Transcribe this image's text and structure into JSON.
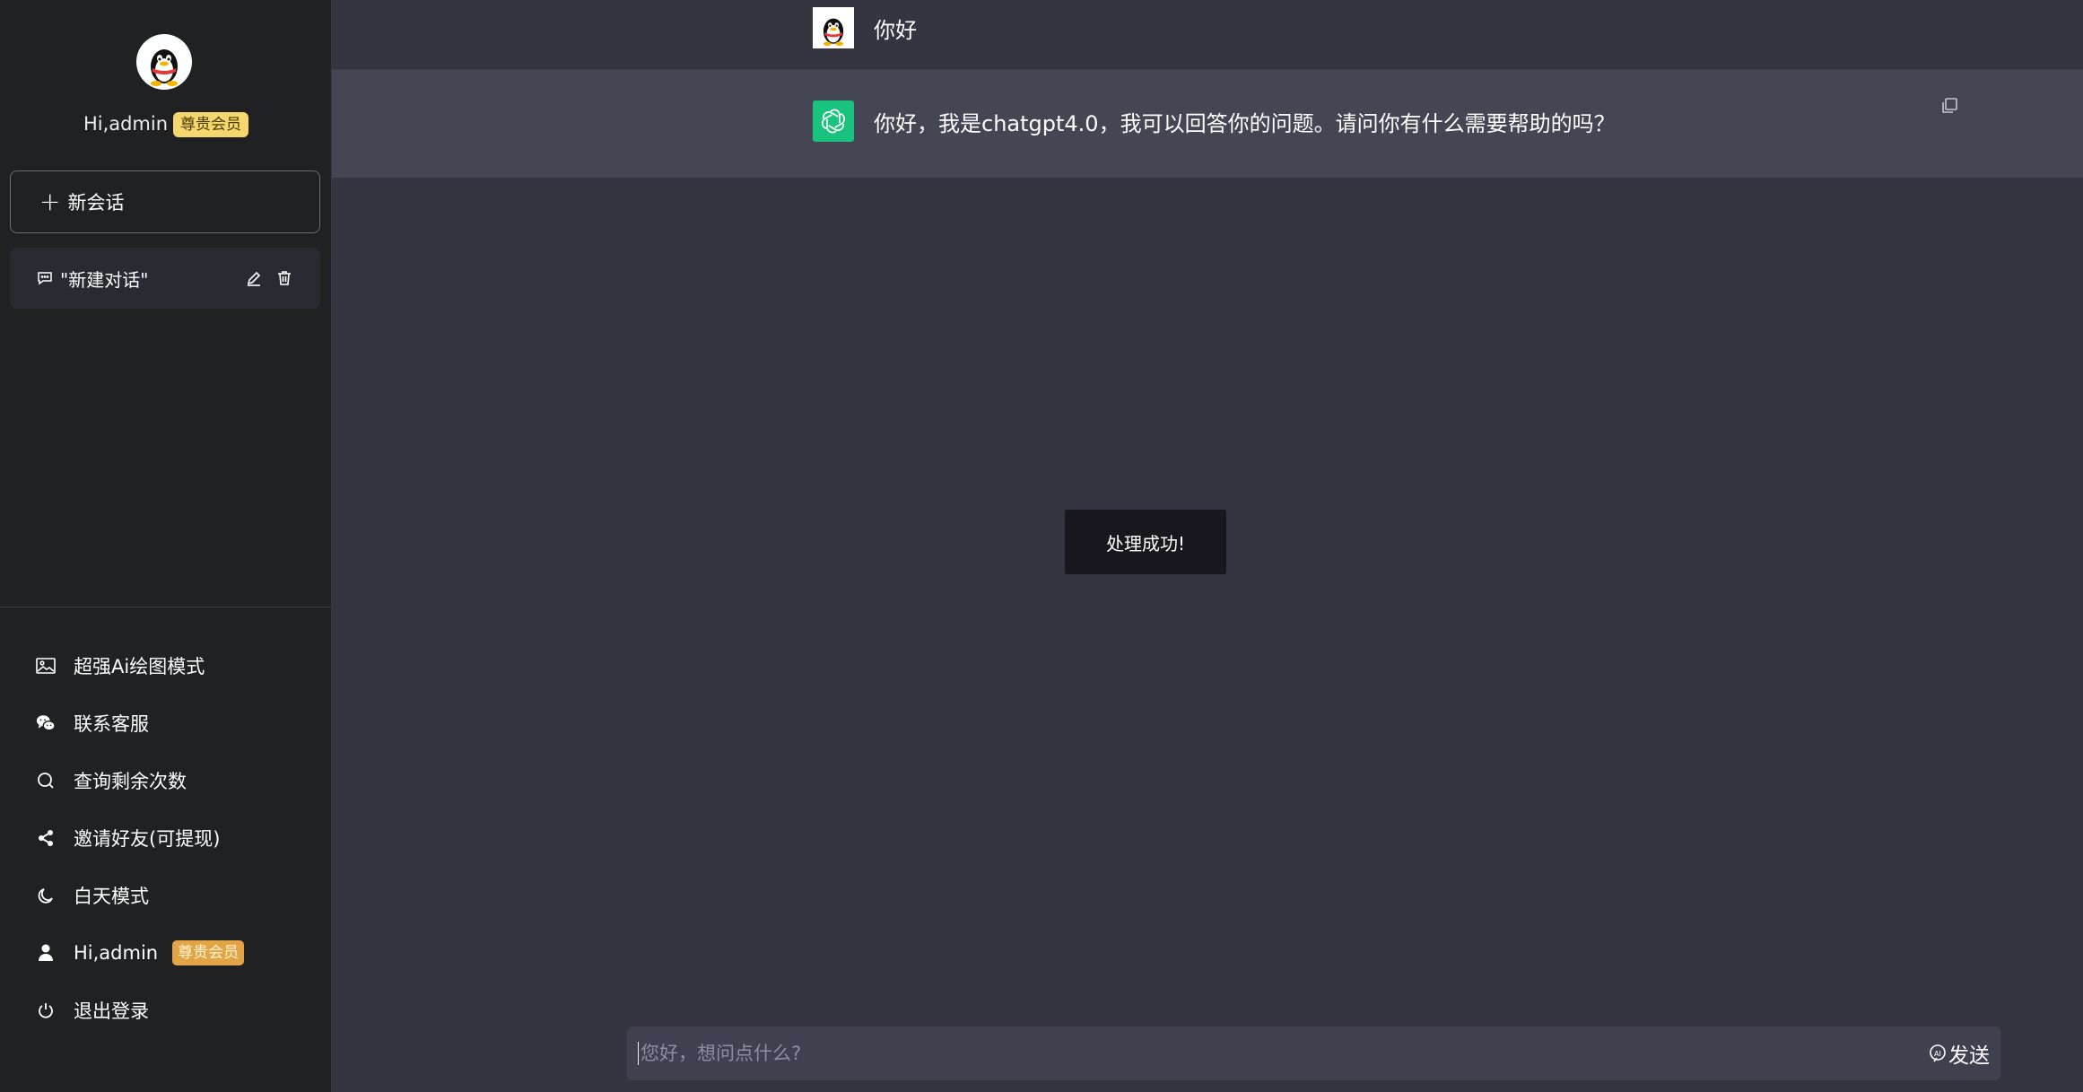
{
  "sidebar": {
    "greeting": "Hi,admin",
    "badge": "尊贵会员",
    "new_chat_label": "新会话",
    "conversation": {
      "title": "\"新建对话\""
    },
    "menu": [
      {
        "label": "超强Ai绘图模式",
        "icon": "image-icon"
      },
      {
        "label": "联系客服",
        "icon": "wechat-icon"
      },
      {
        "label": "查询剩余次数",
        "icon": "search-icon"
      },
      {
        "label": "邀请好友(可提现)",
        "icon": "share-icon"
      },
      {
        "label": "白天模式",
        "icon": "moon-icon"
      },
      {
        "label": "Hi,admin",
        "icon": "user-icon",
        "badge": "尊贵会员"
      },
      {
        "label": "退出登录",
        "icon": "power-icon"
      }
    ]
  },
  "chat": {
    "user_message": "你好",
    "bot_message": "你好，我是chatgpt4.0，我可以回答你的问题。请问你有什么需要帮助的吗？"
  },
  "toast": "处理成功!",
  "input": {
    "placeholder": "您好，想问点什么?",
    "value": ""
  },
  "send_label": "发送",
  "colors": {
    "sidebar_bg": "#202123",
    "main_bg": "#343541",
    "bot_row_bg": "#444654",
    "openai_green": "#19c37d",
    "badge_yellow": "#f5d76e",
    "badge_orange": "#e3a447"
  }
}
